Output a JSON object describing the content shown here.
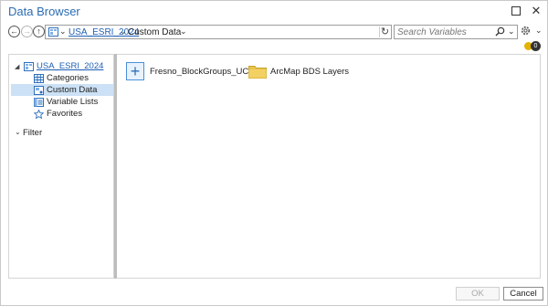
{
  "window": {
    "title": "Data Browser"
  },
  "address": {
    "root": "USA_ESRI_2024",
    "current": "Custom Data"
  },
  "search": {
    "placeholder": "Search Variables"
  },
  "notifications": {
    "count": "0"
  },
  "tree": {
    "root": "USA_ESRI_2024",
    "items": [
      {
        "label": "Categories",
        "icon": "grid-icon"
      },
      {
        "label": "Custom Data",
        "icon": "custom-data-icon",
        "selected": true
      },
      {
        "label": "Variable Lists",
        "icon": "list-icon"
      },
      {
        "label": "Favorites",
        "icon": "star-icon"
      }
    ],
    "filter": "Filter"
  },
  "content": {
    "items": [
      {
        "label": "Fresno_BlockGroups_UCRev",
        "icon": "add-icon"
      },
      {
        "label": "ArcMap BDS Layers",
        "icon": "folder-icon"
      }
    ]
  },
  "footer": {
    "ok": "OK",
    "cancel": "Cancel"
  },
  "colors": {
    "accent": "#2b6cb5",
    "link": "#1e5fb5",
    "selected": "#cce1f5",
    "folder": "#e8c44a"
  }
}
